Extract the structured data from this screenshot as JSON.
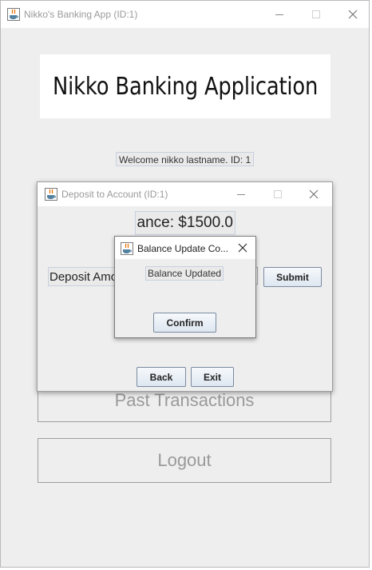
{
  "main_window": {
    "title": "Nikko's Banking App (ID:1)",
    "banner_title": "Nikko Banking Application",
    "welcome_text": "Welcome nikko lastname. ID: 1",
    "past_transactions_label": "Past Transactions",
    "logout_label": "Logout"
  },
  "deposit_dialog": {
    "title": "Deposit to Account (ID:1)",
    "balance_text": "ance: $1500.0",
    "amount_label": "Deposit Amo",
    "submit_label": "Submit",
    "back_label": "Back",
    "exit_label": "Exit"
  },
  "update_dialog": {
    "title": "Balance Update Co...",
    "message": "Balance Updated",
    "confirm_label": "Confirm"
  },
  "icons": {
    "app": "java-coffee-cup-icon",
    "minimize": "minimize-icon",
    "maximize": "maximize-icon",
    "close": "close-icon"
  },
  "colors": {
    "window_bg": "#eeeeee",
    "titlebar_bg": "#ffffff",
    "button_gradient_top": "#f6f9fc",
    "button_gradient_bottom": "#dde6f0",
    "button_border": "#7a8aa0"
  }
}
